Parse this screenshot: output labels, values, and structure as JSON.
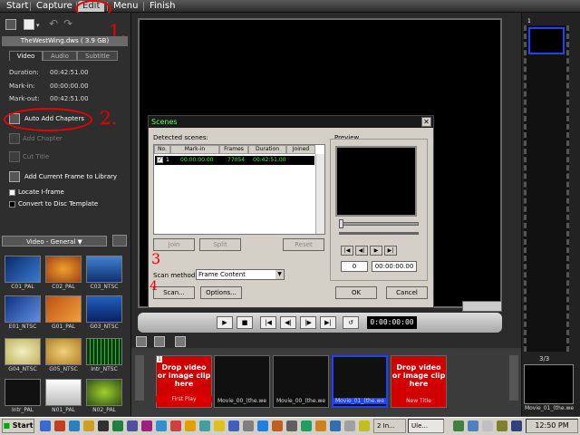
{
  "menu": {
    "items": [
      "Start",
      "Capture",
      "Edit",
      "Menu",
      "Finish"
    ]
  },
  "left": {
    "file_name": "TheWestWing.dws ( 3.9 GB)",
    "tabs": [
      "Video",
      "Audio",
      "Subtitle"
    ],
    "duration_label": "Duration:",
    "duration_value": "00:42:51.00",
    "markin_label": "Mark-in:",
    "markin_value": "00:00:00.00",
    "markout_label": "Mark-out:",
    "markout_value": "00:42:51.00",
    "auto_add_chapters": "Auto Add Chapters",
    "add_chapter": "Add Chapter",
    "cut_title": "Cut Title",
    "add_current_frame": "Add Current Frame to Library",
    "locate_iframe": "Locate I-frame",
    "convert_disc": "Convert to Disc Template",
    "library_category": "Video - General",
    "thumbs": [
      "C01_PAL",
      "C02_PAL",
      "C03_NTSC",
      "E01_NTSC",
      "G01_PAL",
      "G03_NTSC",
      "G04_NTSC",
      "G05_NTSC",
      "Intr_NTSC",
      "Intr_PAL",
      "N01_PAL",
      "N02_PAL"
    ]
  },
  "annotations": {
    "one": "1.",
    "two": "2.",
    "three": "3",
    "four": "4"
  },
  "dialog": {
    "title": "Scenes",
    "detected_label": "Detected scenes:",
    "preview_label": "Preview",
    "columns": [
      "No.",
      "Mark-in",
      "Frames",
      "Duration",
      "Joined"
    ],
    "row": {
      "no": "1",
      "markin": "00:00:00.00",
      "frames": "77054",
      "duration": "00:42:51.00"
    },
    "join_button": "Join",
    "split_button": "Split",
    "reset_button": "Reset",
    "scan_method_label": "Scan method:",
    "scan_method_value": "Frame Content",
    "scan_button": "Scan...",
    "options_button": "Options...",
    "frame_value": "0",
    "time_value": "00:00:00.00",
    "ok_button": "OK",
    "cancel_button": "Cancel"
  },
  "player": {
    "timecode": "0:00:00:00"
  },
  "timeline": {
    "clips": [
      {
        "label": "First Play",
        "text": "Drop video or image clip here"
      },
      {
        "label": "Movie_00_(the.we"
      },
      {
        "label": "Movie_00_(the.we"
      },
      {
        "label": "Movie_01_(the.we"
      },
      {
        "label": "New Title",
        "text": "Drop video or image clip here"
      }
    ],
    "first_index": "1"
  },
  "right": {
    "page": "3/3",
    "thumb_label": "Movie_01_(the.we",
    "top_index": "1"
  },
  "taskbar": {
    "start": "Start",
    "item1": "2 In...",
    "item2": "Ule...",
    "clock": "12:50 PM"
  }
}
